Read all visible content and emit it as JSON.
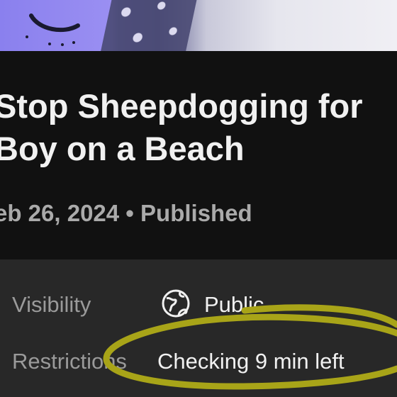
{
  "video": {
    "title_line1": "Stop Sheepdogging for",
    "title_line2": "Boy on a Beach",
    "date_status": "eb 26, 2024 • Published"
  },
  "details": {
    "visibility_label": "Visibility",
    "visibility_value": "Public",
    "visibility_icon": "globe-icon",
    "restrictions_label": "Restrictions",
    "restrictions_value": "Checking 9 min left"
  },
  "colors": {
    "background": "#0f0f0f",
    "details_background": "#282828",
    "text_primary": "#f1f1f1",
    "text_secondary": "#aaaaaa",
    "annotation": "#a8a418"
  }
}
